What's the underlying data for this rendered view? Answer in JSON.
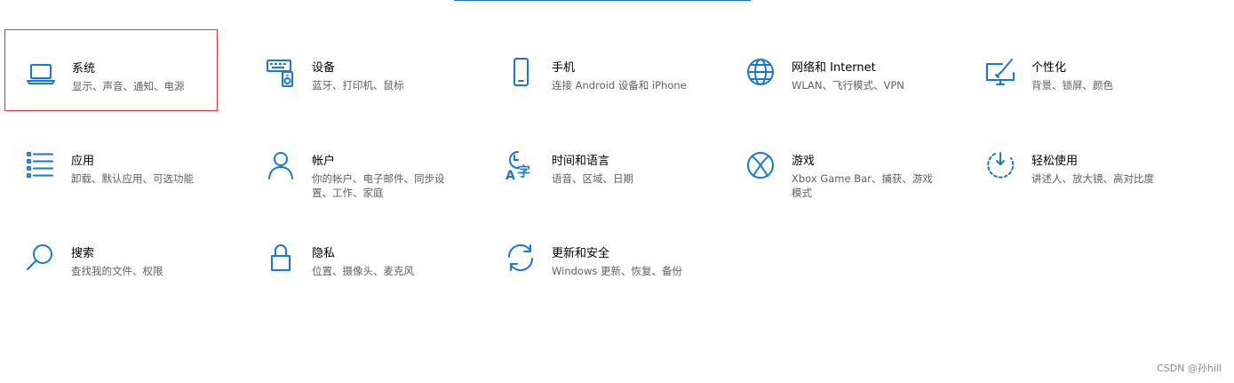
{
  "colors": {
    "accent": "#1877d2",
    "highlight_border": "#e0363b",
    "description_text": "#5f5f5f"
  },
  "tiles": [
    {
      "title": "系统",
      "desc": "显示、声音、通知、电源",
      "icon": "laptop-icon",
      "highlighted": true
    },
    {
      "title": "设备",
      "desc": "蓝牙、打印机、鼠标",
      "icon": "keyboard-speaker-icon"
    },
    {
      "title": "手机",
      "desc": "连接 Android 设备和 iPhone",
      "icon": "phone-icon"
    },
    {
      "title": "网络和 Internet",
      "desc": "WLAN、飞行模式、VPN",
      "icon": "globe-icon"
    },
    {
      "title": "个性化",
      "desc": "背景、锁屏、颜色",
      "icon": "paint-monitor-icon"
    },
    {
      "title": "应用",
      "desc": "卸载、默认应用、可选功能",
      "icon": "apps-list-icon"
    },
    {
      "title": "帐户",
      "desc": "你的帐户、电子邮件、同步设置、工作、家庭",
      "icon": "person-icon"
    },
    {
      "title": "时间和语言",
      "desc": "语音、区域、日期",
      "icon": "time-language-icon"
    },
    {
      "title": "游戏",
      "desc": "Xbox Game Bar、捕获、游戏模式",
      "icon": "xbox-icon"
    },
    {
      "title": "轻松使用",
      "desc": "讲述人、放大镜、高对比度",
      "icon": "ease-of-access-icon"
    },
    {
      "title": "搜索",
      "desc": "查找我的文件、权限",
      "icon": "search-icon"
    },
    {
      "title": "隐私",
      "desc": "位置、摄像头、麦克风",
      "icon": "lock-icon"
    },
    {
      "title": "更新和安全",
      "desc": "Windows 更新、恢复、备份",
      "icon": "sync-icon"
    }
  ],
  "watermark": "CSDN @孙hill"
}
